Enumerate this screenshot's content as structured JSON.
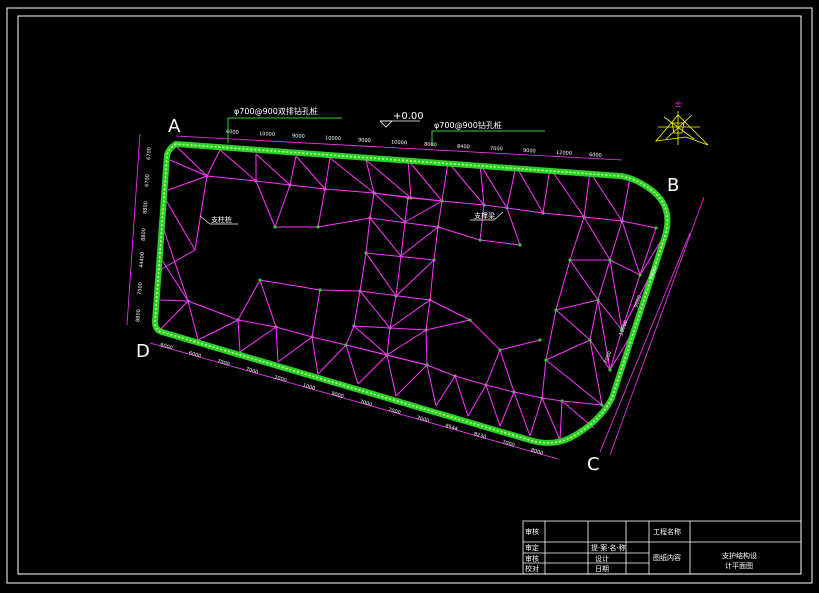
{
  "drawing": {
    "corner_labels": {
      "a": "A",
      "b": "B",
      "c": "C",
      "d": "D"
    },
    "elevation_mark": "+0.00",
    "pile_note_left": "φ700@900双排钻孔桩",
    "pile_note_right": "φ700@900钻孔桩",
    "column_label": "支柱桩",
    "brace_label": "支撑梁",
    "top_dims": [
      "6000",
      "10000",
      "9000",
      "10000",
      "9000",
      "10000",
      "8000",
      "8400",
      "7000",
      "9000",
      "12000",
      "6000"
    ],
    "left_dims": [
      "6700",
      "6700",
      "8800",
      "8800",
      "44400",
      "7000",
      "8800"
    ],
    "bottom_dims": [
      "6000",
      "6000",
      "7000",
      "7000",
      "1000",
      "1000",
      "9000",
      "7000",
      "7000",
      "7000",
      "8544",
      "8230",
      "7000",
      "8000"
    ],
    "right_dims": [
      "9000",
      "9000",
      "10000",
      "7000"
    ]
  },
  "title_block": {
    "row1": [
      "审核",
      "",
      "",
      "工程名称",
      ""
    ],
    "row2": [
      "审定",
      "",
      "提·案·名·称",
      "图纸内容",
      "支护结构设"
    ],
    "row3": [
      "审核",
      "",
      "设计",
      "",
      "计平面图"
    ],
    "row4": [
      "校对",
      "",
      "日期",
      "",
      ""
    ]
  },
  "colors": {
    "frame": "#ffffff",
    "structure": "#ff33ff",
    "pile": "#33cc33",
    "pile_fill": "#99ff66",
    "text": "#ffffff",
    "compass": "#ffff00"
  }
}
